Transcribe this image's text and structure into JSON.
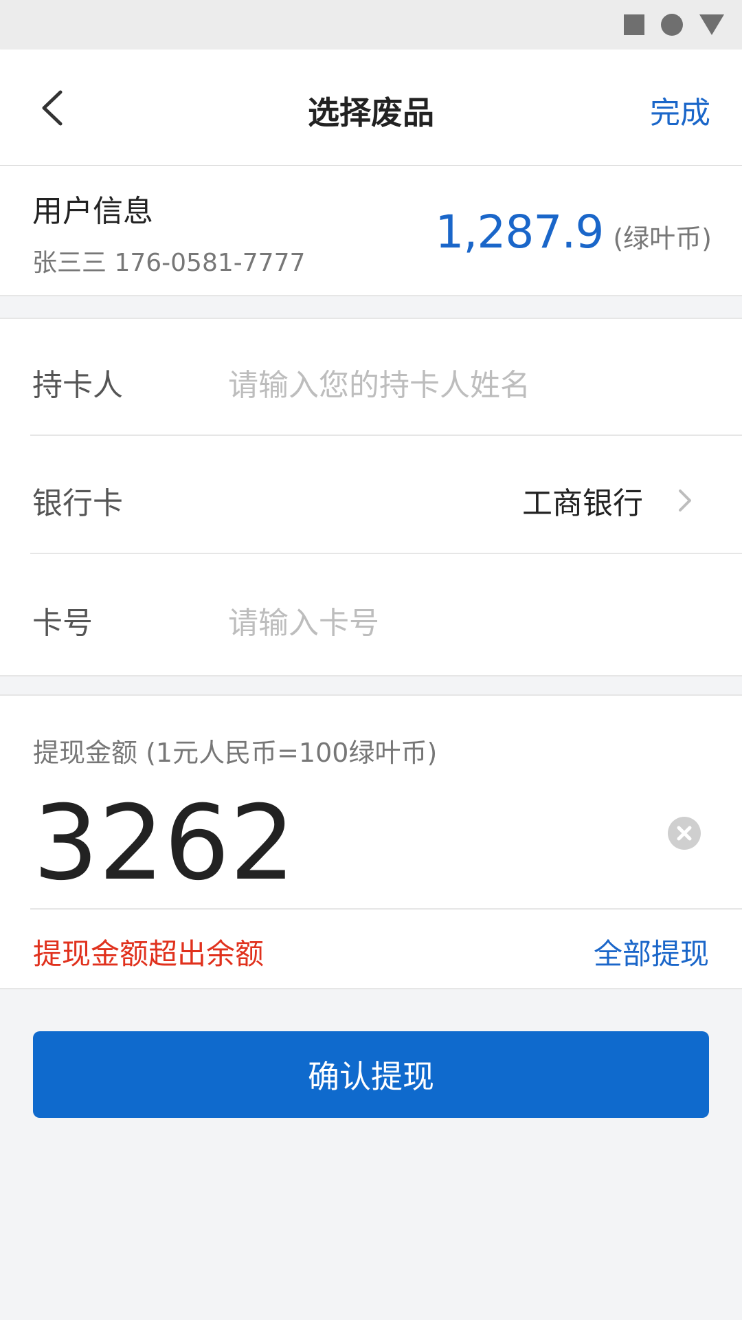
{
  "nav": {
    "title": "选择废品",
    "done_label": "完成"
  },
  "user": {
    "title": "用户信息",
    "sub": "张三三 176-0581-7777",
    "balance": "1,287.9",
    "unit": "(绿叶币)"
  },
  "form": {
    "cardholder": {
      "label": "持卡人",
      "placeholder": "请输入您的持卡人姓名"
    },
    "bank": {
      "label": "银行卡",
      "value": "工商银行"
    },
    "cardno": {
      "label": "卡号",
      "placeholder": "请输入卡号"
    }
  },
  "amount": {
    "label": "提现金额 (1元人民币=100绿叶币)",
    "value": "3262",
    "error": "提现金额超出余额",
    "withdraw_all": "全部提现"
  },
  "confirm_label": "确认提现",
  "colors": {
    "accent": "#1a66c9",
    "button": "#0f6acd",
    "error": "#e0311d"
  },
  "icons": {
    "back": "chevron-left",
    "bank_chevron": "chevron-right",
    "clear": "close-circle",
    "status": [
      "stop-square",
      "record-circle",
      "triangle-down"
    ]
  }
}
